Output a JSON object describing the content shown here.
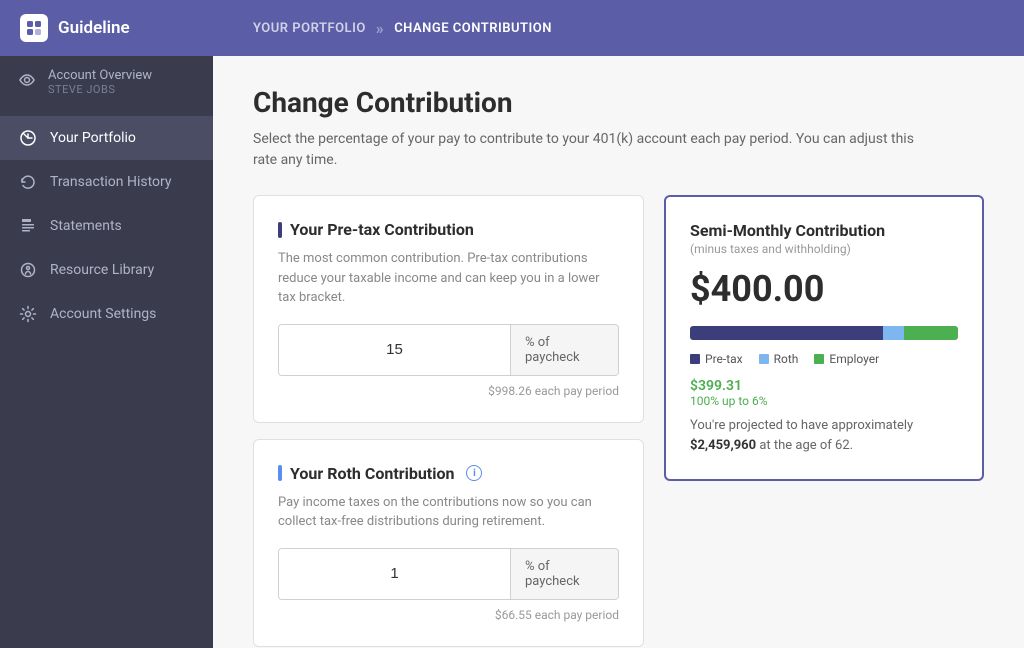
{
  "app": {
    "logo": "Guideline",
    "breadcrumb": {
      "parent": "YOUR PORTFOLIO",
      "separator": "»",
      "current": "CHANGE CONTRIBUTION"
    }
  },
  "sidebar": {
    "account": {
      "name": "Account Overview",
      "user": "STEVE JOBS"
    },
    "items": [
      {
        "id": "your-portfolio",
        "label": "Your Portfolio",
        "icon": "portfolio",
        "active": true
      },
      {
        "id": "transaction-history",
        "label": "Transaction History",
        "icon": "history",
        "active": false
      },
      {
        "id": "statements",
        "label": "Statements",
        "icon": "statements",
        "active": false
      },
      {
        "id": "resource-library",
        "label": "Resource Library",
        "icon": "resource",
        "active": false
      },
      {
        "id": "account-settings",
        "label": "Account Settings",
        "icon": "settings",
        "active": false
      }
    ]
  },
  "page": {
    "title": "Change Contribution",
    "description": "Select the percentage of your pay to contribute to your 401(k) account each pay period. You can adjust this rate any time."
  },
  "pretax": {
    "title": "Your Pre-tax Contribution",
    "description": "The most common contribution. Pre-tax contributions reduce your taxable income and can keep you in a lower tax bracket.",
    "value": "15",
    "suffix": "% of paycheck",
    "note": "$998.26 each pay period"
  },
  "roth": {
    "title": "Your Roth Contribution",
    "description": "Pay income taxes on the contributions now so you can collect tax-free distributions during retirement.",
    "value": "1",
    "suffix": "% of paycheck",
    "note": "$66.55 each pay period"
  },
  "semi_monthly": {
    "title": "Semi-Monthly Contribution",
    "subtitle": "(minus taxes and withholding)",
    "amount": "$400.00",
    "bar": {
      "pretax": {
        "pct": 72,
        "color": "#3b3e7a",
        "label": "Pre-tax"
      },
      "roth": {
        "pct": 8,
        "color": "#7eb6f0",
        "label": "Roth"
      },
      "employer": {
        "pct": 20,
        "color": "#4caf50",
        "label": "Employer"
      }
    },
    "match_amount": "$399.31",
    "match_desc": "100% up to 6%",
    "projection": "You're projected to have approximately",
    "projection_amount": "$2,459,960",
    "projection_suffix": "at the age of 62."
  }
}
